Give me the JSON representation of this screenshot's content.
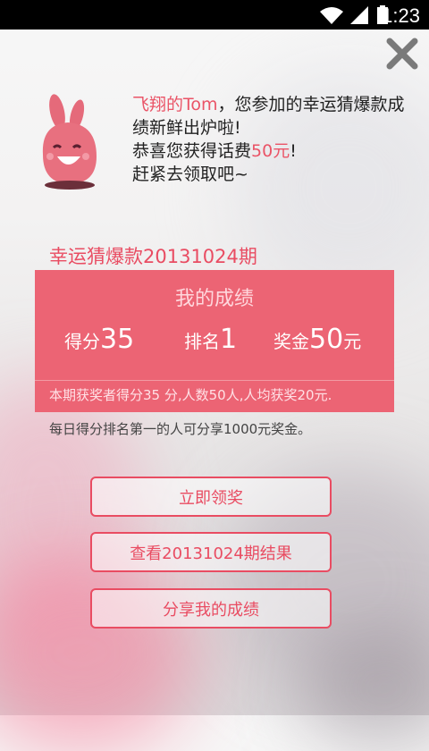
{
  "status_bar": {
    "time": "1:23"
  },
  "close_icon": "close-icon",
  "message": {
    "line1_name": "飞翔的Tom",
    "line1_rest": "，您参加的幸运猜爆款成绩新鲜出炉啦!",
    "line2_prefix": "恭喜您获得话费",
    "line2_highlight": "50元",
    "line2_suffix": "!",
    "line3": "赶紧去领取吧~"
  },
  "period_title": "幸运猜爆款20131024期",
  "score_card": {
    "title": "我的成绩",
    "score_label": "得分",
    "score_value": "35",
    "rank_label": "排名",
    "rank_value": "1",
    "prize_label": "奖金",
    "prize_value": "50",
    "prize_unit": "元",
    "note": "本期获奖者得分35 分,人数50人,人均获奖20元."
  },
  "daily_note": "每日得分排名第一的人可分享1000元奖金。",
  "buttons": {
    "claim": "立即领奖",
    "view_results": "查看20131024期结果",
    "share": "分享我的成绩"
  },
  "colors": {
    "accent": "#e94c62",
    "card": "#ec6474"
  }
}
